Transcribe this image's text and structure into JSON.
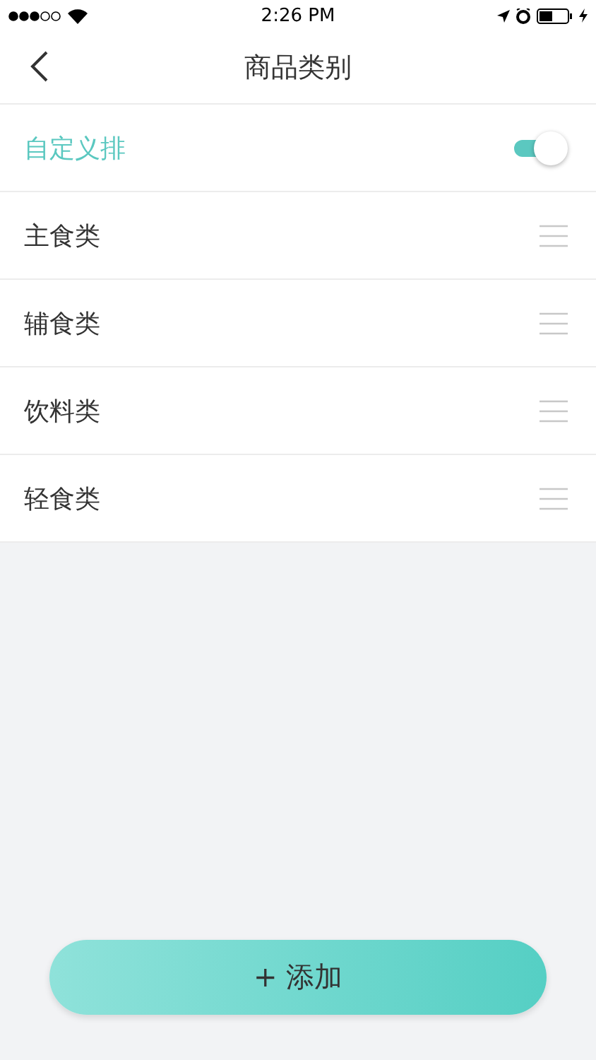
{
  "status_bar": {
    "time": "2:26 PM"
  },
  "nav": {
    "title": "商品类别"
  },
  "custom_sort": {
    "label": "自定义排",
    "on": true
  },
  "categories": [
    {
      "name": "主食类"
    },
    {
      "name": "辅食类"
    },
    {
      "name": "饮料类"
    },
    {
      "name": "轻食类"
    }
  ],
  "add_button": {
    "label": "+ 添加"
  }
}
